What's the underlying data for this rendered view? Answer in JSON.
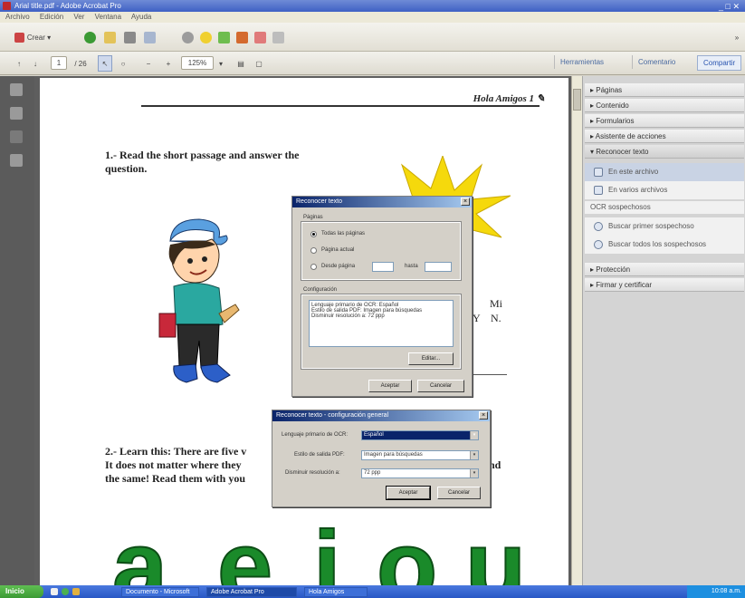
{
  "window": {
    "title": "Arial title.pdf - Adobe Acrobat Pro"
  },
  "menu": {
    "items": [
      "Archivo",
      "Edición",
      "Ver",
      "Ventana",
      "Ayuda"
    ]
  },
  "toolbar": {
    "create_label": "Crear",
    "page_number": "1",
    "page_total": "/ 26",
    "zoom": "125%"
  },
  "tabs": {
    "tools": "Herramientas",
    "comment": "Comentario",
    "share": "Compartir"
  },
  "right_panel": {
    "sections": [
      "Páginas",
      "Contenido",
      "Formularios",
      "Asistente de acciones",
      "Reconocer texto"
    ],
    "recognize_items": [
      "En este archivo",
      "En varios archivos"
    ],
    "suspects_header": "OCR sospechosos",
    "suspect_items": [
      "Buscar primer sospechoso",
      "Buscar todos los sospechosos"
    ],
    "more_sections": [
      "Protección",
      "Firmar y certificar"
    ]
  },
  "page": {
    "header": "Hola Amigos 1",
    "exercise1": "1.- Read the short passage and answer the question.",
    "exercise2_lines": [
      "2.- Learn this: There are five v",
      "It does not matter where they",
      "the same! Read them with you"
    ],
    "exercise2_tail": "nd",
    "side_text": [
      "Mi",
      "N."
    ],
    "side_letter": "Y",
    "big_letters": [
      "a",
      "e",
      "i",
      "o",
      "u"
    ]
  },
  "dialog1": {
    "title": "Reconocer texto",
    "pages_group": "Páginas",
    "radio_all": "Todas las páginas",
    "radio_current": "Página actual",
    "radio_from": "Desde página",
    "to_label": "hasta",
    "settings_group": "Configuración",
    "settings_lines": [
      "Lenguaje primario de OCR: Español",
      "Estilo de salida PDF: Imagen para búsquedas",
      "Disminuir resolución a: 72 ppp"
    ],
    "edit_button": "Editar...",
    "ok_button": "Aceptar",
    "cancel_button": "Cancelar"
  },
  "dialog2": {
    "title": "Reconocer texto - configuración general",
    "lang_label": "Lenguaje primario de OCR:",
    "lang_value": "Español",
    "style_label": "Estilo de salida PDF:",
    "style_value": "Imagen para búsquedas",
    "res_label": "Disminuir resolución a:",
    "res_value": "72 ppp",
    "ok_button": "Aceptar",
    "cancel_button": "Cancelar"
  },
  "taskbar": {
    "start": "Inicio",
    "tasks": [
      "Documento - Microsoft",
      "Adobe Acrobat Pro",
      "Hola Amigos"
    ],
    "clock": "10:08 a.m."
  },
  "colors": {
    "sun": "#f5d90c",
    "big_letters": "#1a8a2a",
    "dialog_title": "#0a246a"
  }
}
